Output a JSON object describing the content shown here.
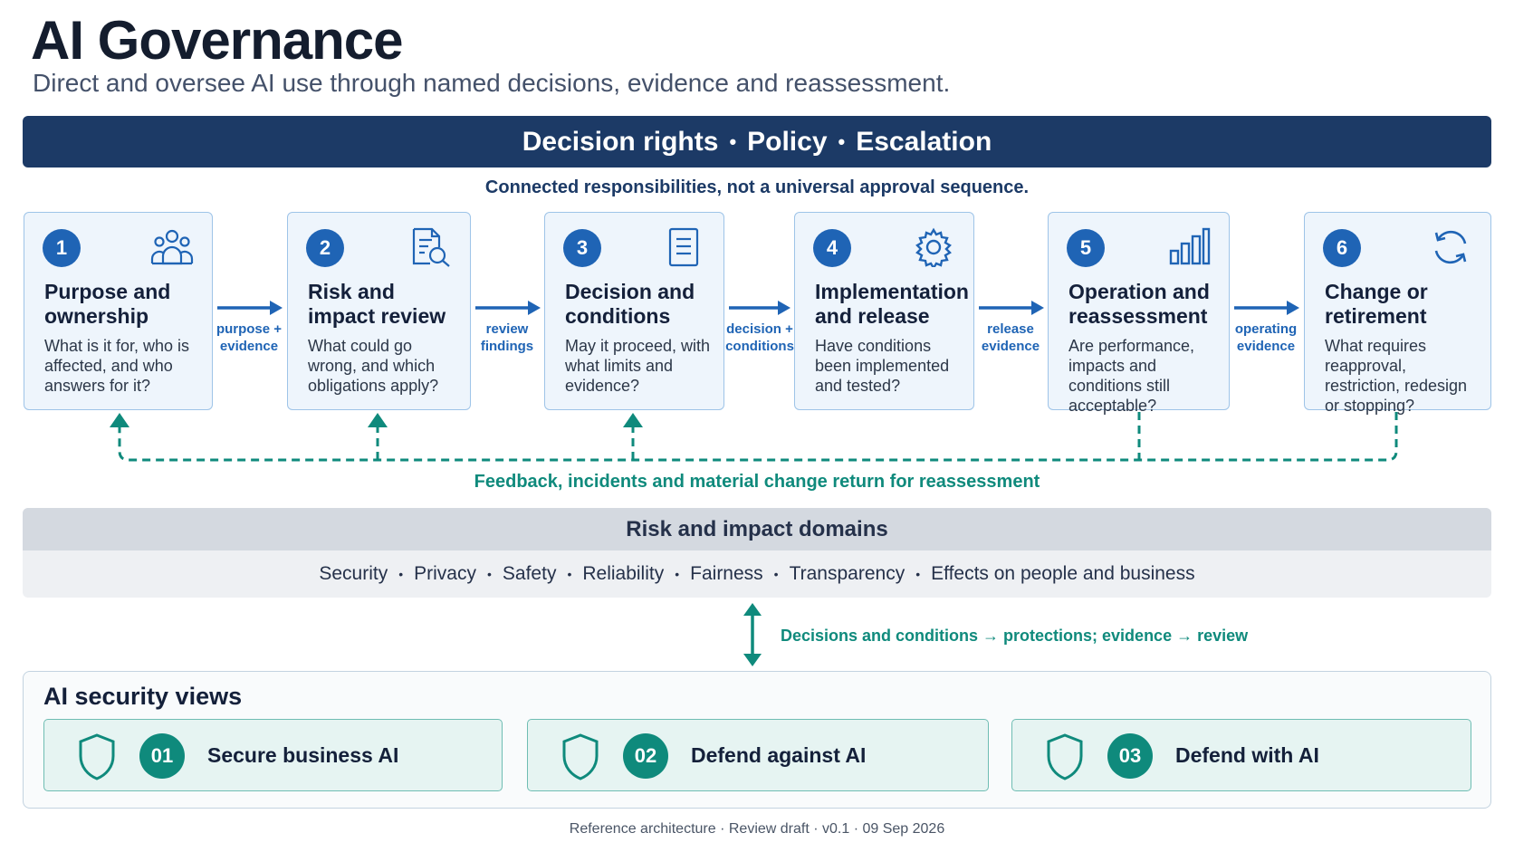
{
  "header": {
    "title": "AI Governance",
    "subtitle": "Direct and oversee AI use through named decisions, evidence and reassessment."
  },
  "banner": {
    "items": [
      "Decision rights",
      "Policy",
      "Escalation"
    ],
    "separator": "•"
  },
  "flow_note": "Connected responsibilities, not a universal approval sequence.",
  "steps": [
    {
      "num": "1",
      "title": "Purpose and ownership",
      "desc": "What is it for, who is affected, and who answers for it?",
      "icon": "people-icon"
    },
    {
      "num": "2",
      "title": "Risk and impact review",
      "desc": "What could go wrong, and which obligations apply?",
      "icon": "document-search-icon"
    },
    {
      "num": "3",
      "title": "Decision and conditions",
      "desc": "May it proceed, with what limits and evidence?",
      "icon": "document-icon"
    },
    {
      "num": "4",
      "title": "Implementation and release",
      "desc": "Have conditions been implemented and tested?",
      "icon": "gear-icon"
    },
    {
      "num": "5",
      "title": "Operation and reassessment",
      "desc": "Are performance, impacts and conditions still acceptable?",
      "icon": "bar-chart-icon"
    },
    {
      "num": "6",
      "title": "Change or retirement",
      "desc": "What requires reapproval, restriction, redesign or stopping?",
      "icon": "refresh-icon"
    }
  ],
  "connectors": [
    {
      "line1": "purpose +",
      "line2": "evidence"
    },
    {
      "line1": "review",
      "line2": "findings"
    },
    {
      "line1": "decision +",
      "line2": "conditions"
    },
    {
      "line1": "release",
      "line2": "evidence"
    },
    {
      "line1": "operating",
      "line2": "evidence"
    }
  ],
  "feedback_label": "Feedback, incidents and material change return for reassessment",
  "domains": {
    "heading": "Risk and impact domains",
    "items": [
      "Security",
      "Privacy",
      "Safety",
      "Reliability",
      "Fairness",
      "Transparency",
      "Effects on people and business"
    ],
    "separator": "•"
  },
  "link_label": "Decisions and conditions → protections; evidence → review",
  "security_views": {
    "heading": "AI security views",
    "items": [
      {
        "num": "01",
        "label": "Secure business AI",
        "icon": "shield-icon"
      },
      {
        "num": "02",
        "label": "Defend against AI",
        "icon": "shield-icon"
      },
      {
        "num": "03",
        "label": "Defend with AI",
        "icon": "shield-icon"
      }
    ]
  },
  "footer": "Reference architecture · Review draft · v0.1 · 09 Sep 2026",
  "colors": {
    "navy": "#1c3a66",
    "blue_accent": "#1f64b5",
    "teal_accent": "#0f8a7c",
    "card_fill": "#eef5fc",
    "card_border": "#9ec4e8"
  }
}
